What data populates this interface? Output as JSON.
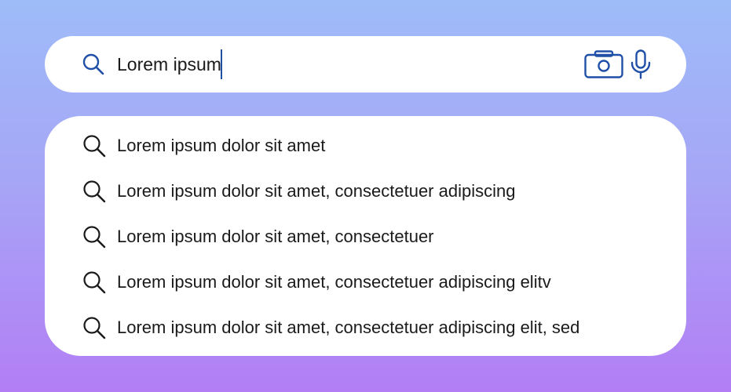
{
  "search": {
    "value": "Lorem ipsum",
    "icons": {
      "leading": "search-icon",
      "camera": "camera-icon",
      "microphone": "microphone-icon"
    }
  },
  "suggestions": [
    {
      "text": "Lorem ipsum dolor sit amet",
      "icon": "search-icon"
    },
    {
      "text": "Lorem ipsum dolor sit amet, consectetuer adipiscing",
      "icon": "search-icon"
    },
    {
      "text": "Lorem ipsum dolor sit amet, consectetuer",
      "icon": "search-icon"
    },
    {
      "text": "Lorem ipsum dolor sit amet, consectetuer adipiscing elitv",
      "icon": "search-icon"
    },
    {
      "text": "Lorem ipsum dolor sit amet, consectetuer adipiscing elit, sed",
      "icon": "search-icon"
    }
  ],
  "colors": {
    "accent": "#1f4fa6",
    "gradient_top": "#9ebcf8",
    "gradient_bottom": "#b37ef5",
    "surface": "#ffffff",
    "text": "#1a1a1a"
  }
}
